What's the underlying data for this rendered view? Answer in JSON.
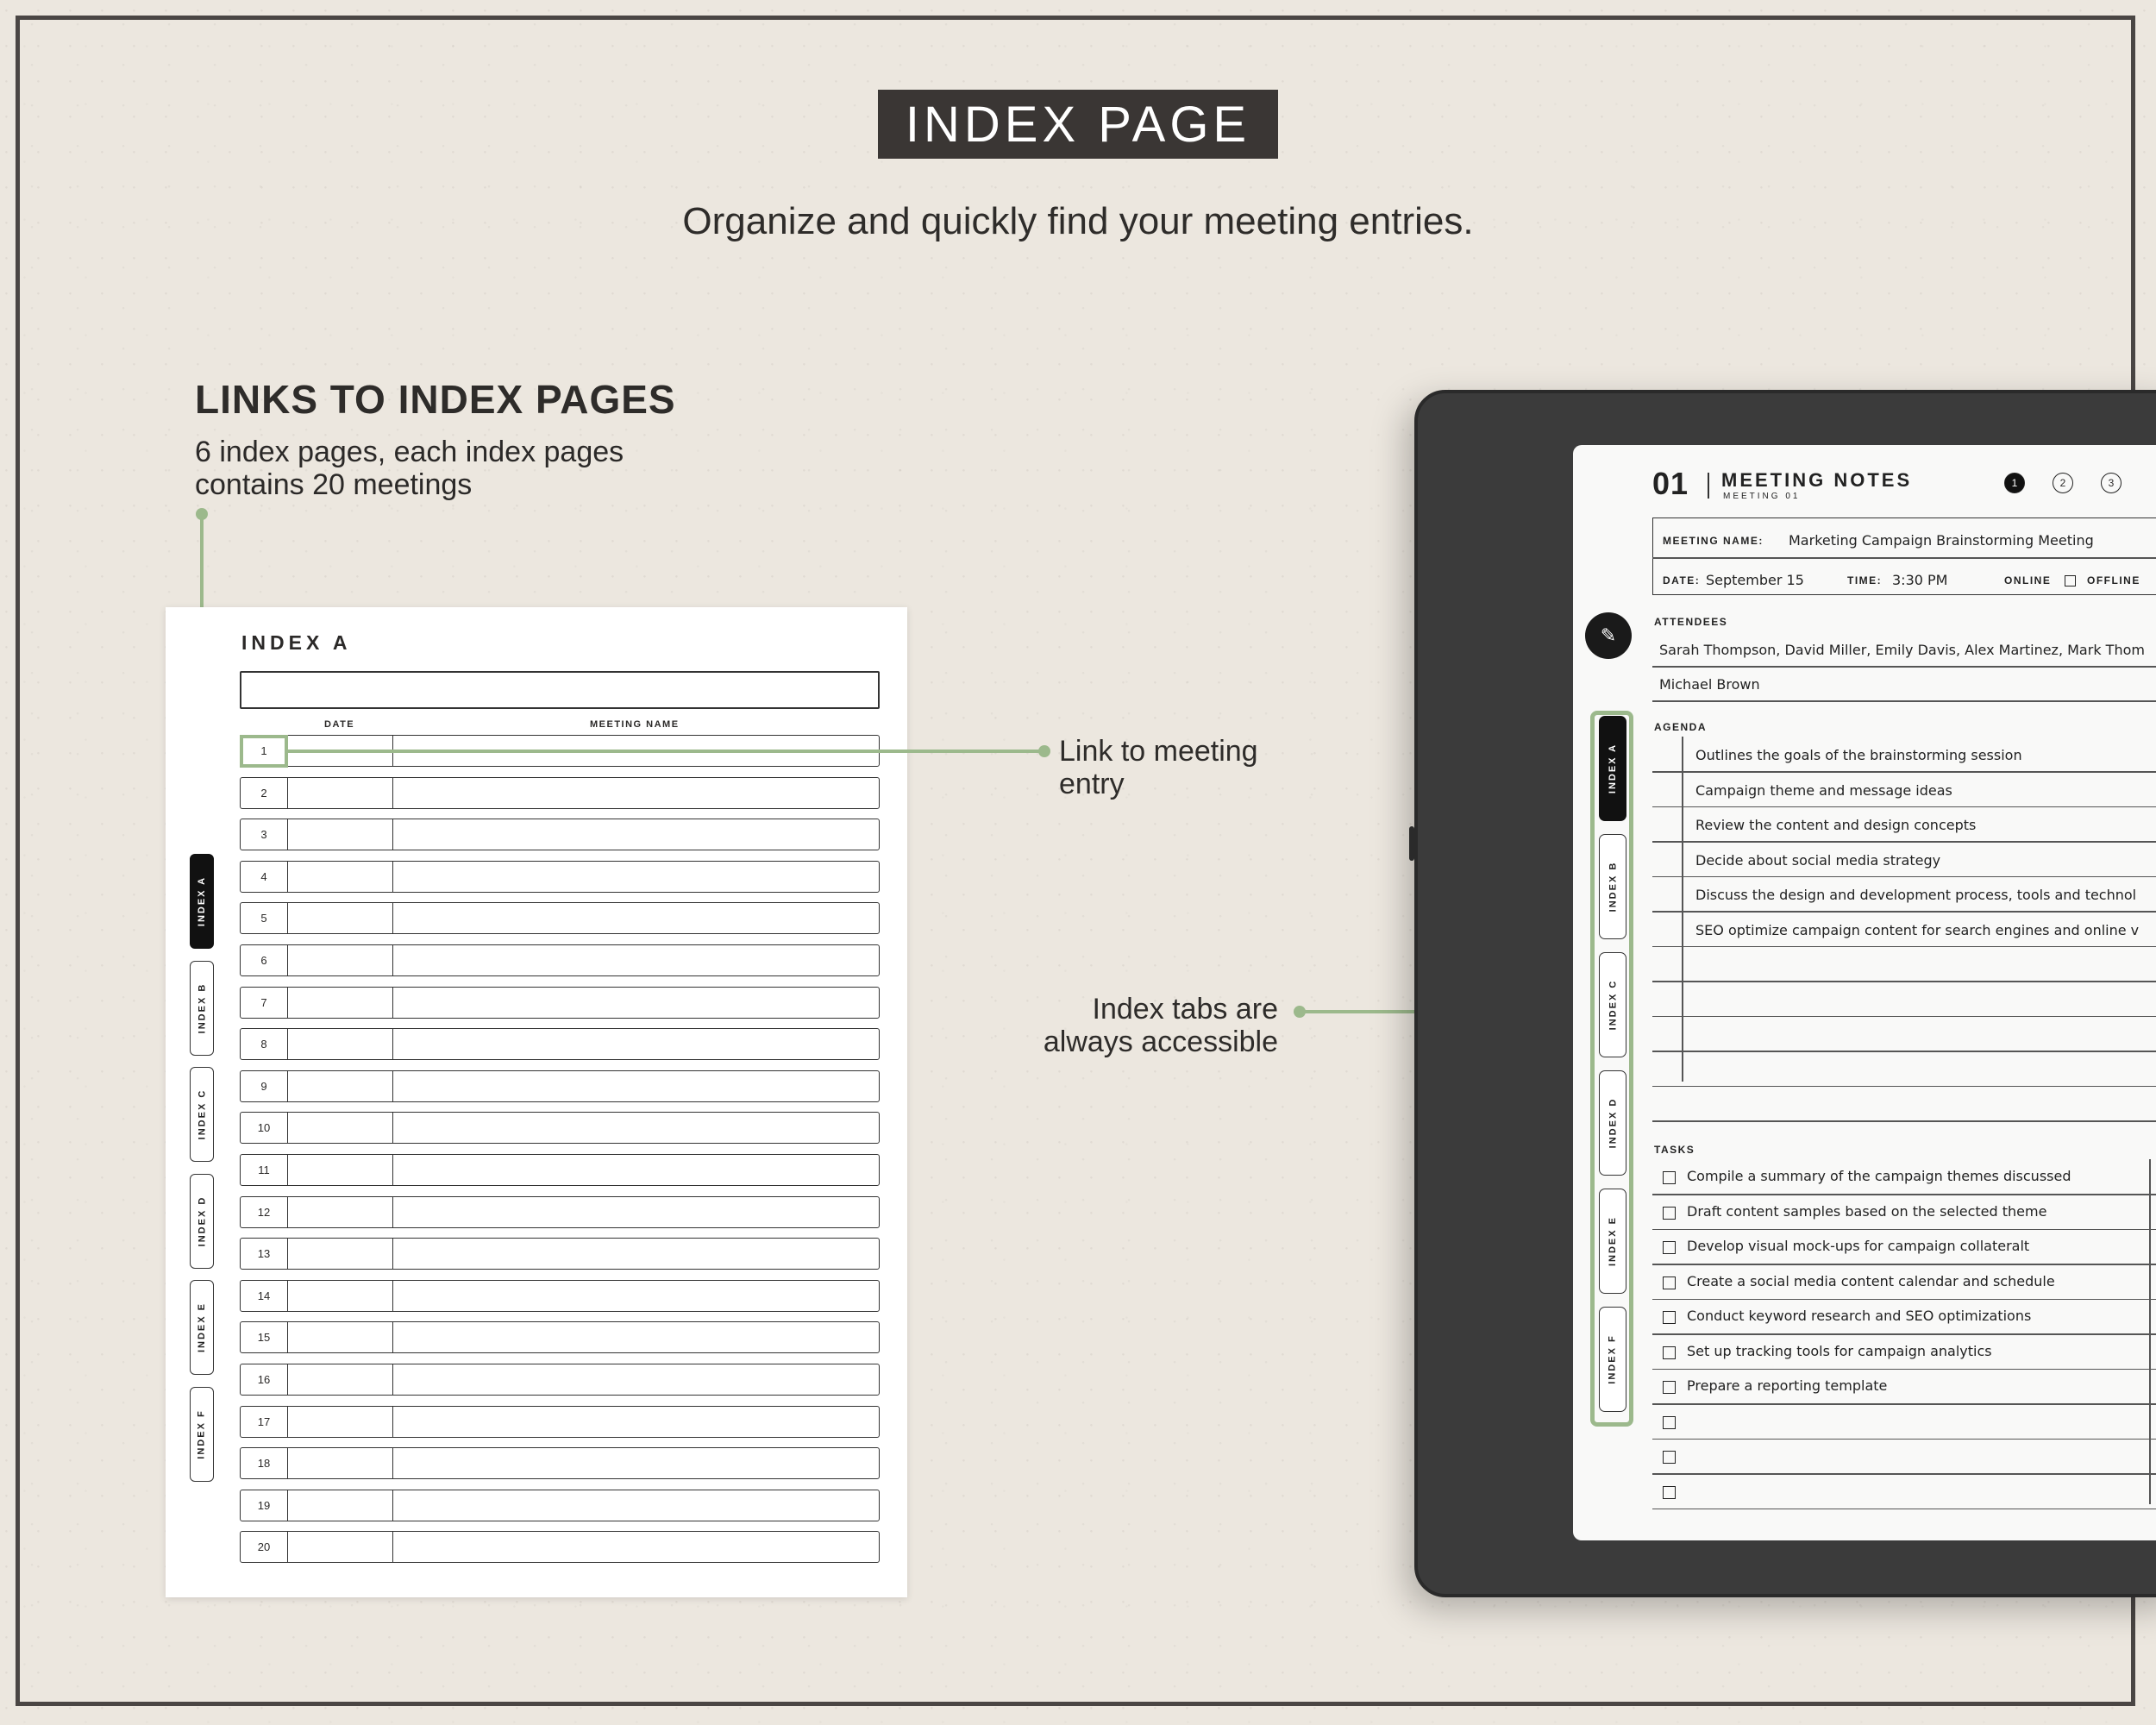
{
  "heading": {
    "title": "INDEX PAGE",
    "subtitle": "Organize and quickly find your meeting entries."
  },
  "links_section": {
    "title": "LINKS TO INDEX PAGES",
    "description": "6 index pages, each index pages contains 20 meetings"
  },
  "callouts": {
    "link_entry": "Link to meeting entry",
    "tabs_accessible": "Index tabs are always accessible"
  },
  "index_page": {
    "title": "INDEX A",
    "col_date": "DATE",
    "col_meeting_name": "MEETING NAME",
    "rows": [
      "1",
      "2",
      "3",
      "4",
      "5",
      "6",
      "7",
      "8",
      "9",
      "10",
      "11",
      "12",
      "13",
      "14",
      "15",
      "16",
      "17",
      "18",
      "19",
      "20"
    ],
    "tabs": [
      "INDEX A",
      "INDEX B",
      "INDEX C",
      "INDEX D",
      "INDEX E",
      "INDEX F"
    ]
  },
  "meeting_screen": {
    "number": "01",
    "title": "MEETING NOTES",
    "subtitle": "MEETING 01",
    "page_dots": [
      "1",
      "2",
      "3"
    ],
    "meeting_name_label": "MEETING NAME:",
    "meeting_name_value": "Marketing Campaign Brainstorming Meeting",
    "date_label": "DATE:",
    "date_value": "September 15",
    "time_label": "TIME:",
    "time_value": "3:30 PM",
    "online_label": "ONLINE",
    "offline_label": "OFFLINE",
    "attendees_label": "ATTENDEES",
    "attendees_line1": "Sarah Thompson, David Miller, Emily Davis, Alex Martinez, Mark Thom",
    "attendees_line2": "Michael Brown",
    "agenda_label": "AGENDA",
    "agenda": [
      "Outlines the goals of the brainstorming session",
      "Campaign theme and message ideas",
      "Review the content and design concepts",
      "Decide about social media strategy",
      "Discuss the design and development process, tools and technol",
      "SEO optimize campaign content for search engines and online v"
    ],
    "tasks_label": "TASKS",
    "tasks": [
      "Compile a summary of the campaign themes discussed",
      "Draft content samples based on the selected theme",
      "Develop visual mock-ups for campaign collateralt",
      "Create a social media content calendar and schedule",
      "Conduct keyword research and SEO optimizations",
      "Set up tracking tools for campaign analytics",
      "Prepare a reporting template"
    ],
    "tabs": [
      "INDEX A",
      "INDEX B",
      "INDEX C",
      "INDEX D",
      "INDEX E",
      "INDEX F"
    ]
  },
  "colors": {
    "background": "#ece7df",
    "accent_green": "#9cb98c",
    "dark": "#3a3634"
  }
}
